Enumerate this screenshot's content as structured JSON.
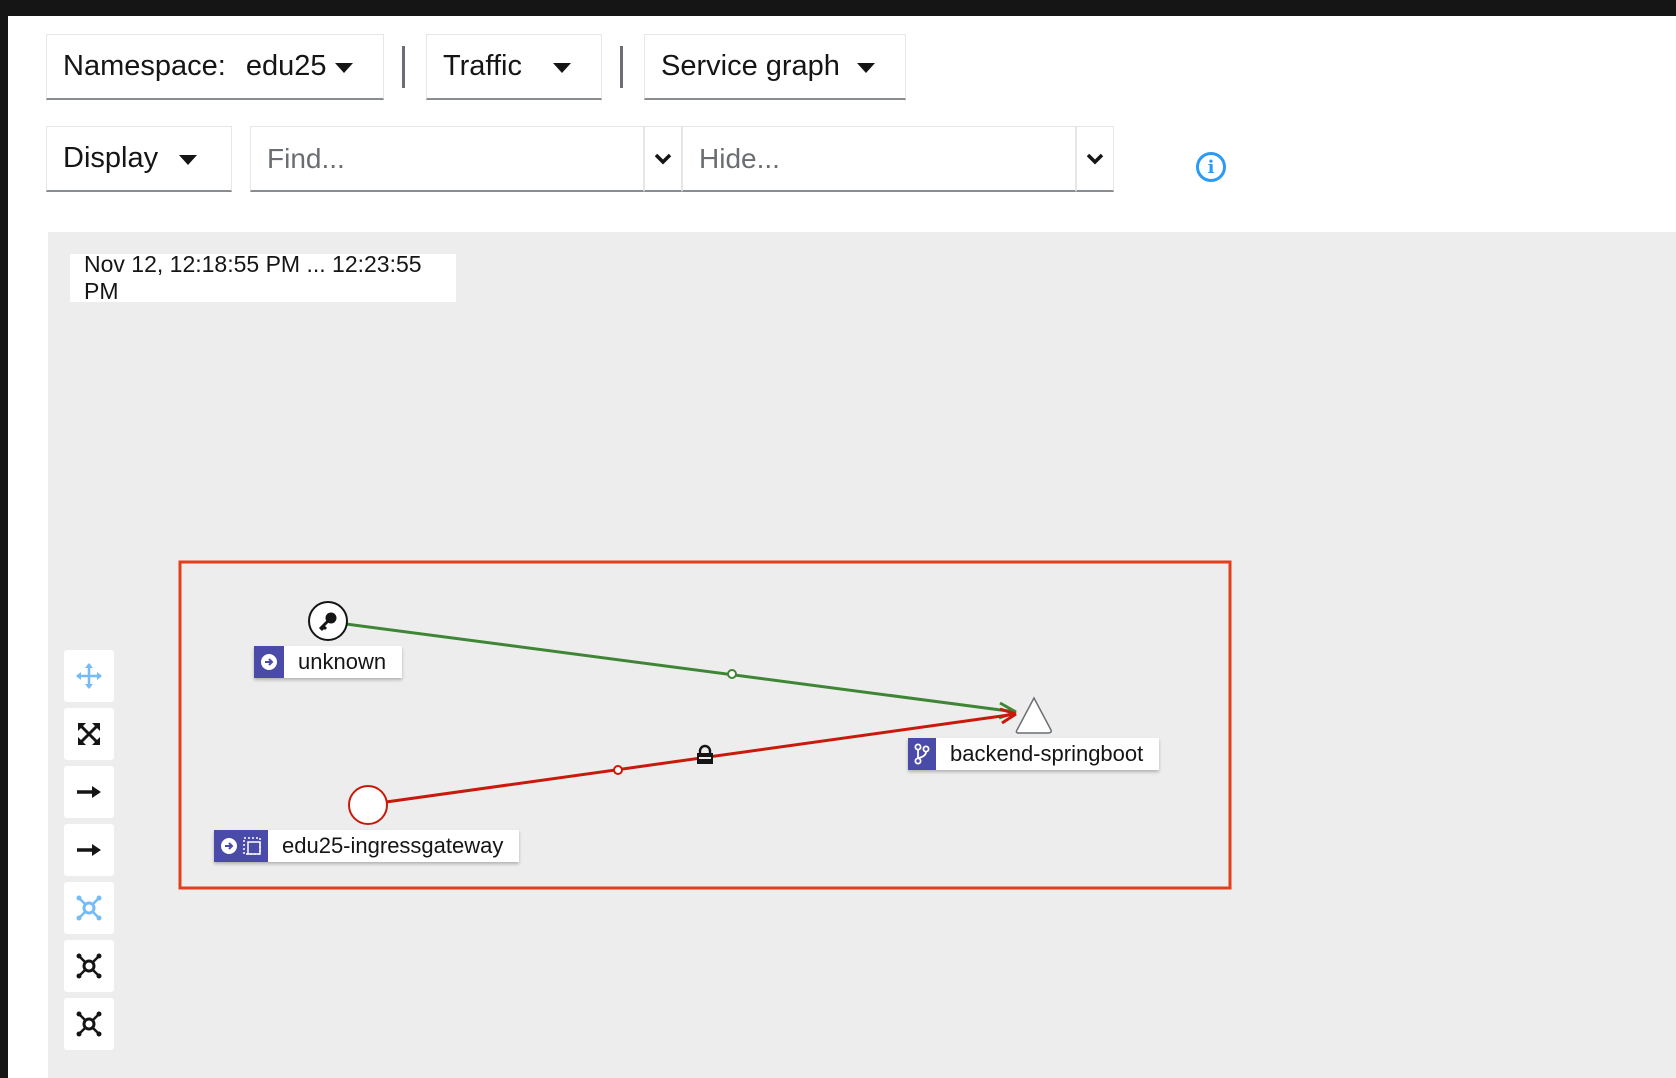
{
  "toolbar": {
    "namespace_label": "Namespace:",
    "namespace_value": "edu25",
    "traffic_label": "Traffic",
    "graph_type_label": "Service graph",
    "display_label": "Display",
    "find_placeholder": "Find...",
    "hide_placeholder": "Hide..."
  },
  "graph": {
    "time_range": "Nov 12, 12:18:55 PM ... 12:23:55 PM",
    "nodes": [
      {
        "name": "unknown",
        "icon": "key-icon",
        "badges": [
          "arrow-right-circle-icon"
        ]
      },
      {
        "name": "edu25-ingressgateway",
        "icon": "circle-node",
        "badges": [
          "arrow-right-circle-icon",
          "dashed-box-icon"
        ]
      },
      {
        "name": "backend-springboot",
        "icon": "triangle-node",
        "badges": [
          "branch-icon"
        ]
      }
    ],
    "edges": [
      {
        "from": "unknown",
        "to": "backend-springboot",
        "status": "healthy",
        "color": "#3e8635"
      },
      {
        "from": "edu25-ingressgateway",
        "to": "backend-springboot",
        "status": "error",
        "color": "#c9190b",
        "mtls": true
      }
    ],
    "highlight_color": "#e2401c"
  },
  "controls": [
    "pan-icon",
    "fit-to-screen-icon",
    "arrow-right-icon",
    "arrow-right-icon",
    "layout-default-icon",
    "layout-1-icon",
    "layout-2-icon"
  ],
  "colors": {
    "accent": "#2b9af3",
    "badge": "#4a4aa8"
  }
}
